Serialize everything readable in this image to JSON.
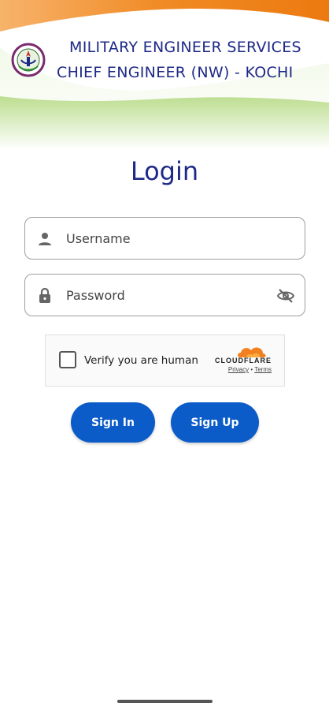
{
  "header": {
    "org_line1": "MILITARY ENGINEER SERVICES",
    "org_line2": "CHIEF ENGINEER (NW) - KOCHI",
    "logo_icon": "mes-emblem-icon"
  },
  "login": {
    "title": "Login",
    "username_placeholder": "Username",
    "password_placeholder": "Password",
    "username_icon": "person-icon",
    "password_icon": "lock-icon",
    "toggle_icon": "eye-off-icon"
  },
  "captcha": {
    "label": "Verify you are human",
    "brand": "CLOUDFLARE",
    "privacy": "Privacy",
    "separator": "•",
    "terms": "Terms"
  },
  "actions": {
    "sign_in": "Sign In",
    "sign_up": "Sign Up"
  },
  "colors": {
    "primary": "#0b5cc8",
    "heading": "#1e2a87",
    "saffron": "#f08a24",
    "green": "#7fbf2a"
  }
}
